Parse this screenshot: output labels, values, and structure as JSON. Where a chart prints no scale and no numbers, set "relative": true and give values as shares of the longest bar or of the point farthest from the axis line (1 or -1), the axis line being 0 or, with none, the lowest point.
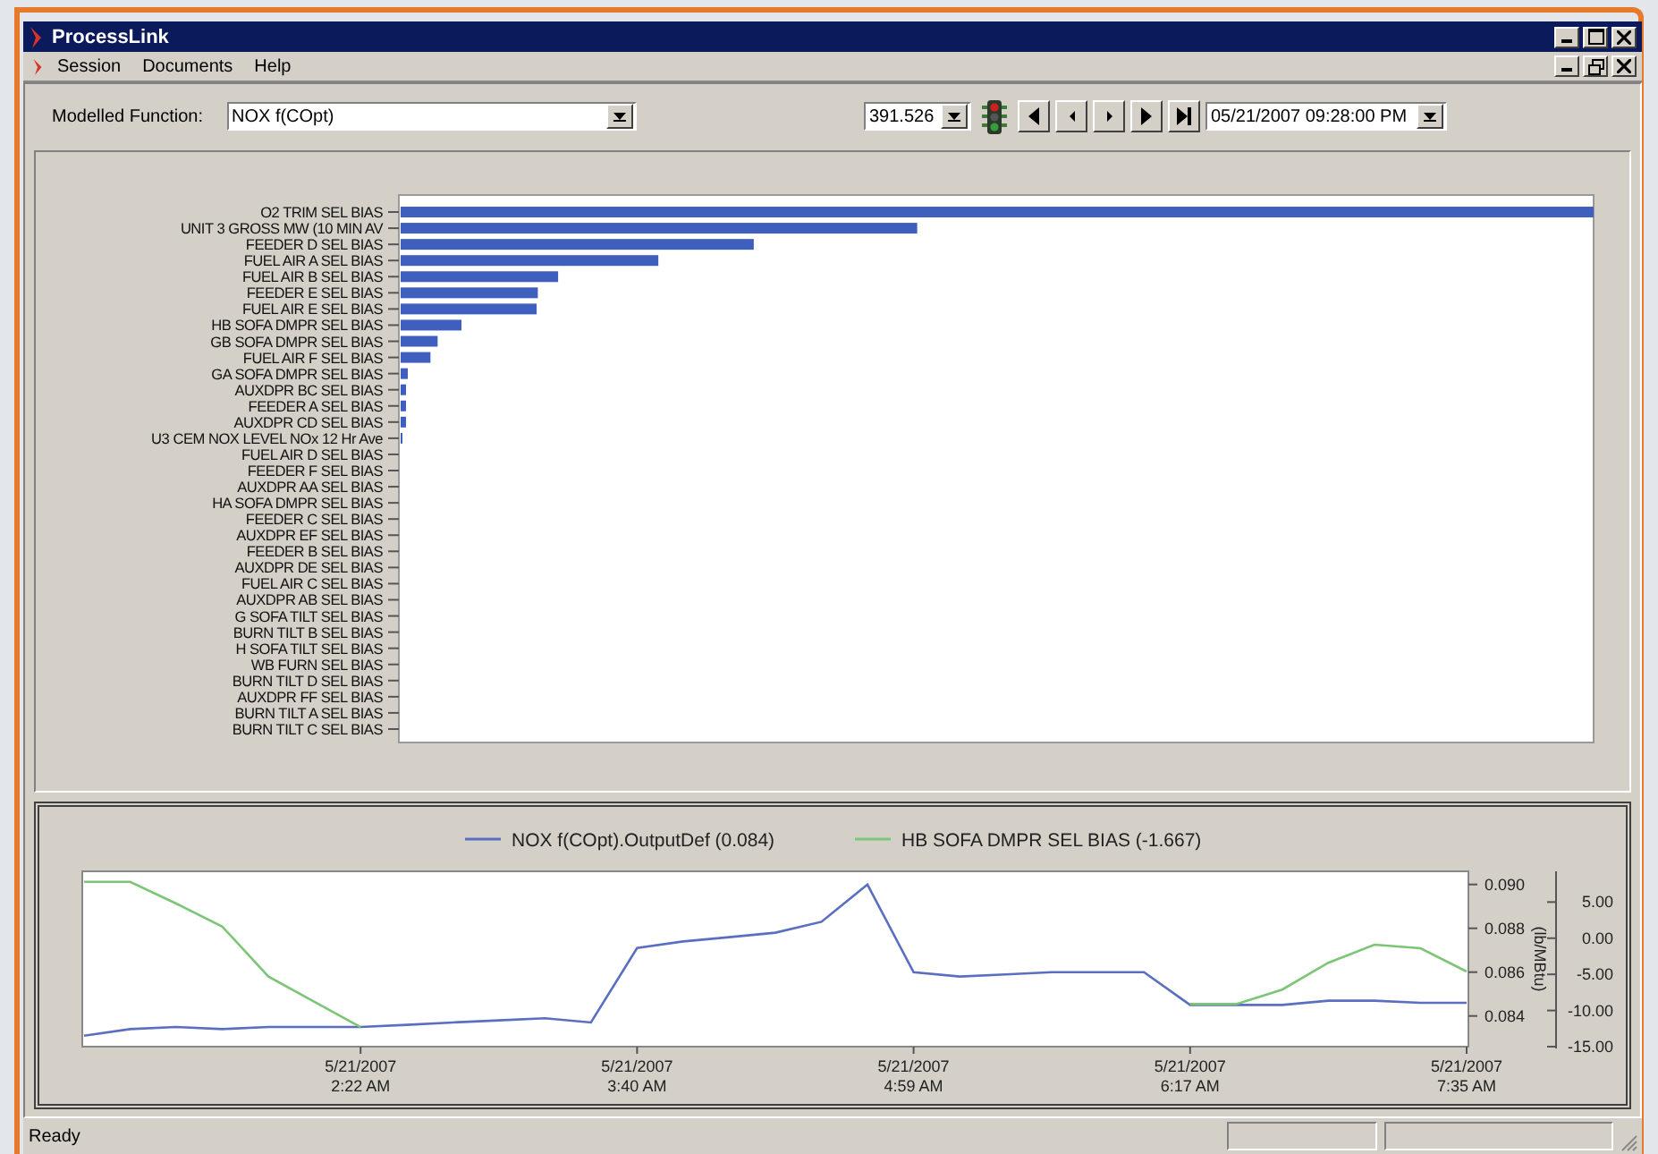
{
  "window": {
    "title": "ProcessLink"
  },
  "menu": [
    {
      "label": "Session"
    },
    {
      "label": "Documents"
    },
    {
      "label": "Help"
    }
  ],
  "toolbar": {
    "function_label": "Modelled Function:",
    "function_value": "NOX f(COpt)",
    "value": "391.526",
    "timestamp": "05/21/2007 09:28:00 PM"
  },
  "bar_panel": {
    "chart_data": {
      "type": "bar",
      "orientation": "horizontal",
      "relative": true,
      "categories": [
        "O2 TRIM SEL BIAS",
        "UNIT 3 GROSS MW (10 MIN AV",
        "FEEDER D SEL BIAS",
        "FUEL AIR A SEL BIAS",
        "FUEL AIR B SEL BIAS",
        "FEEDER E SEL BIAS",
        "FUEL AIR E SEL BIAS",
        "HB SOFA DMPR SEL BIAS",
        "GB SOFA DMPR SEL BIAS",
        "FUEL AIR F SEL BIAS",
        "GA SOFA DMPR SEL BIAS",
        "AUXDPR BC SEL BIAS",
        "FEEDER A SEL BIAS",
        "AUXDPR CD SEL BIAS",
        "U3 CEM NOX LEVEL NOx 12 Hr Ave",
        "FUEL AIR D SEL BIAS",
        "FEEDER F SEL BIAS",
        "AUXDPR AA SEL BIAS",
        "HA SOFA DMPR SEL BIAS",
        "FEEDER C SEL BIAS",
        "AUXDPR EF SEL BIAS",
        "FEEDER B SEL BIAS",
        "AUXDPR DE SEL BIAS",
        "FUEL AIR C SEL BIAS",
        "AUXDPR AB SEL BIAS",
        "G SOFA TILT SEL BIAS",
        "BURN TILT B SEL BIAS",
        "H SOFA TILT SEL BIAS",
        "WB FURN SEL BIAS",
        "BURN TILT D SEL BIAS",
        "AUXDPR FF SEL BIAS",
        "BURN TILT A SEL BIAS",
        "BURN TILT C SEL BIAS"
      ],
      "values": [
        1,
        0.433,
        0.296,
        0.216,
        0.132,
        0.115,
        0.114,
        0.051,
        0.031,
        0.025,
        0.006,
        0.0045,
        0.0045,
        0.0045,
        0.0015,
        0,
        0,
        0,
        0,
        0,
        0,
        0,
        0,
        0,
        0,
        0,
        0,
        0,
        0,
        0,
        0,
        0,
        0
      ]
    }
  },
  "trend_panel": {
    "chart_data": {
      "type": "line",
      "legend": "top",
      "categories": [
        null,
        null,
        null,
        null,
        null,
        null,
        "5/21/2007\n2:22 AM",
        null,
        null,
        null,
        null,
        null,
        "5/21/2007\n3:40 AM",
        null,
        null,
        null,
        null,
        null,
        "5/21/2007\n4:59 AM",
        null,
        null,
        null,
        null,
        null,
        "5/21/2007\n6:17 AM",
        null,
        null,
        null,
        null,
        null,
        "5/21/2007\n7:35 AM"
      ],
      "series": [
        {
          "name": "NOX f(COpt).OutputDef (0.084)",
          "color": "#5a6fc0",
          "axis": "y",
          "values": [
            0.0831,
            0.0834,
            0.0835,
            0.0834,
            0.0835,
            0.0835,
            0.0835,
            0.0836,
            0.0837,
            0.0838,
            0.0839,
            0.0837,
            0.0871,
            0.0874,
            0.0876,
            0.0878,
            0.0883,
            0.09,
            0.086,
            0.0858,
            0.0859,
            0.086,
            0.086,
            0.086,
            0.0845,
            0.0845,
            0.0845,
            0.0847,
            0.0847,
            0.0846,
            0.0846
          ]
        },
        {
          "name": "HB SOFA DMPR SEL BIAS (-1.667)",
          "color": "#7cc576",
          "axis": "y2",
          "values": [
            7.8,
            7.8,
            4.8,
            1.6,
            -5.3,
            -8.8,
            -12.3,
            null,
            null,
            null,
            null,
            null,
            null,
            null,
            null,
            null,
            null,
            null,
            null,
            null,
            null,
            null,
            null,
            null,
            -9.1,
            -9.1,
            -7.1,
            -3.4,
            -0.9,
            -1.4,
            -4.6
          ]
        }
      ],
      "ylim": [
        0.0826,
        0.0906
      ],
      "yticks": [
        {
          "value": 0.09,
          "label": "0.090"
        },
        {
          "value": 0.088,
          "label": "0.088"
        },
        {
          "value": 0.086,
          "label": "0.086"
        },
        {
          "value": 0.084,
          "label": "0.084"
        }
      ],
      "ylabel": "(lb/MBtu)",
      "y2lim": [
        -15,
        9.25
      ],
      "y2ticks": [
        {
          "value": 5,
          "label": "5.00"
        },
        {
          "value": 0,
          "label": "0.00"
        },
        {
          "value": -5,
          "label": "-5.00"
        },
        {
          "value": -10,
          "label": "-10.00"
        },
        {
          "value": -15,
          "label": "-15.00"
        }
      ]
    }
  },
  "status_bar": {
    "text": "Ready"
  }
}
